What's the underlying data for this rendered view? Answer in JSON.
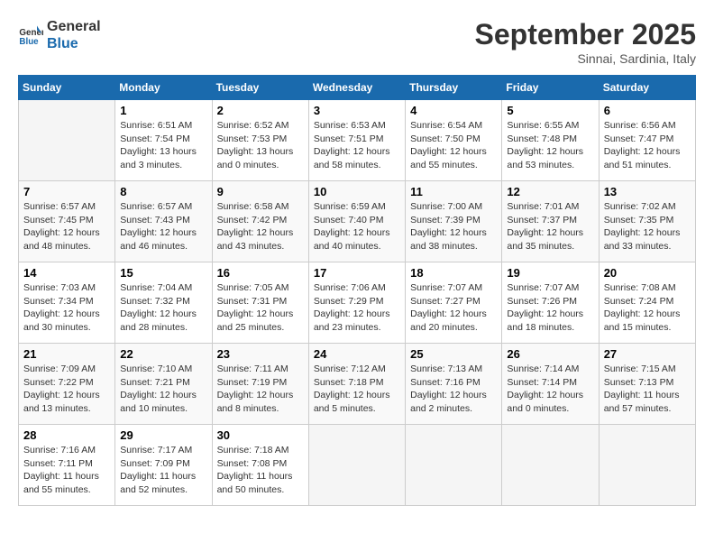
{
  "header": {
    "logo_line1": "General",
    "logo_line2": "Blue",
    "month": "September 2025",
    "location": "Sinnai, Sardinia, Italy"
  },
  "weekdays": [
    "Sunday",
    "Monday",
    "Tuesday",
    "Wednesday",
    "Thursday",
    "Friday",
    "Saturday"
  ],
  "weeks": [
    [
      {
        "day": "",
        "sunrise": "",
        "sunset": "",
        "daylight": ""
      },
      {
        "day": "1",
        "sunrise": "Sunrise: 6:51 AM",
        "sunset": "Sunset: 7:54 PM",
        "daylight": "Daylight: 13 hours and 3 minutes."
      },
      {
        "day": "2",
        "sunrise": "Sunrise: 6:52 AM",
        "sunset": "Sunset: 7:53 PM",
        "daylight": "Daylight: 13 hours and 0 minutes."
      },
      {
        "day": "3",
        "sunrise": "Sunrise: 6:53 AM",
        "sunset": "Sunset: 7:51 PM",
        "daylight": "Daylight: 12 hours and 58 minutes."
      },
      {
        "day": "4",
        "sunrise": "Sunrise: 6:54 AM",
        "sunset": "Sunset: 7:50 PM",
        "daylight": "Daylight: 12 hours and 55 minutes."
      },
      {
        "day": "5",
        "sunrise": "Sunrise: 6:55 AM",
        "sunset": "Sunset: 7:48 PM",
        "daylight": "Daylight: 12 hours and 53 minutes."
      },
      {
        "day": "6",
        "sunrise": "Sunrise: 6:56 AM",
        "sunset": "Sunset: 7:47 PM",
        "daylight": "Daylight: 12 hours and 51 minutes."
      }
    ],
    [
      {
        "day": "7",
        "sunrise": "Sunrise: 6:57 AM",
        "sunset": "Sunset: 7:45 PM",
        "daylight": "Daylight: 12 hours and 48 minutes."
      },
      {
        "day": "8",
        "sunrise": "Sunrise: 6:57 AM",
        "sunset": "Sunset: 7:43 PM",
        "daylight": "Daylight: 12 hours and 46 minutes."
      },
      {
        "day": "9",
        "sunrise": "Sunrise: 6:58 AM",
        "sunset": "Sunset: 7:42 PM",
        "daylight": "Daylight: 12 hours and 43 minutes."
      },
      {
        "day": "10",
        "sunrise": "Sunrise: 6:59 AM",
        "sunset": "Sunset: 7:40 PM",
        "daylight": "Daylight: 12 hours and 40 minutes."
      },
      {
        "day": "11",
        "sunrise": "Sunrise: 7:00 AM",
        "sunset": "Sunset: 7:39 PM",
        "daylight": "Daylight: 12 hours and 38 minutes."
      },
      {
        "day": "12",
        "sunrise": "Sunrise: 7:01 AM",
        "sunset": "Sunset: 7:37 PM",
        "daylight": "Daylight: 12 hours and 35 minutes."
      },
      {
        "day": "13",
        "sunrise": "Sunrise: 7:02 AM",
        "sunset": "Sunset: 7:35 PM",
        "daylight": "Daylight: 12 hours and 33 minutes."
      }
    ],
    [
      {
        "day": "14",
        "sunrise": "Sunrise: 7:03 AM",
        "sunset": "Sunset: 7:34 PM",
        "daylight": "Daylight: 12 hours and 30 minutes."
      },
      {
        "day": "15",
        "sunrise": "Sunrise: 7:04 AM",
        "sunset": "Sunset: 7:32 PM",
        "daylight": "Daylight: 12 hours and 28 minutes."
      },
      {
        "day": "16",
        "sunrise": "Sunrise: 7:05 AM",
        "sunset": "Sunset: 7:31 PM",
        "daylight": "Daylight: 12 hours and 25 minutes."
      },
      {
        "day": "17",
        "sunrise": "Sunrise: 7:06 AM",
        "sunset": "Sunset: 7:29 PM",
        "daylight": "Daylight: 12 hours and 23 minutes."
      },
      {
        "day": "18",
        "sunrise": "Sunrise: 7:07 AM",
        "sunset": "Sunset: 7:27 PM",
        "daylight": "Daylight: 12 hours and 20 minutes."
      },
      {
        "day": "19",
        "sunrise": "Sunrise: 7:07 AM",
        "sunset": "Sunset: 7:26 PM",
        "daylight": "Daylight: 12 hours and 18 minutes."
      },
      {
        "day": "20",
        "sunrise": "Sunrise: 7:08 AM",
        "sunset": "Sunset: 7:24 PM",
        "daylight": "Daylight: 12 hours and 15 minutes."
      }
    ],
    [
      {
        "day": "21",
        "sunrise": "Sunrise: 7:09 AM",
        "sunset": "Sunset: 7:22 PM",
        "daylight": "Daylight: 12 hours and 13 minutes."
      },
      {
        "day": "22",
        "sunrise": "Sunrise: 7:10 AM",
        "sunset": "Sunset: 7:21 PM",
        "daylight": "Daylight: 12 hours and 10 minutes."
      },
      {
        "day": "23",
        "sunrise": "Sunrise: 7:11 AM",
        "sunset": "Sunset: 7:19 PM",
        "daylight": "Daylight: 12 hours and 8 minutes."
      },
      {
        "day": "24",
        "sunrise": "Sunrise: 7:12 AM",
        "sunset": "Sunset: 7:18 PM",
        "daylight": "Daylight: 12 hours and 5 minutes."
      },
      {
        "day": "25",
        "sunrise": "Sunrise: 7:13 AM",
        "sunset": "Sunset: 7:16 PM",
        "daylight": "Daylight: 12 hours and 2 minutes."
      },
      {
        "day": "26",
        "sunrise": "Sunrise: 7:14 AM",
        "sunset": "Sunset: 7:14 PM",
        "daylight": "Daylight: 12 hours and 0 minutes."
      },
      {
        "day": "27",
        "sunrise": "Sunrise: 7:15 AM",
        "sunset": "Sunset: 7:13 PM",
        "daylight": "Daylight: 11 hours and 57 minutes."
      }
    ],
    [
      {
        "day": "28",
        "sunrise": "Sunrise: 7:16 AM",
        "sunset": "Sunset: 7:11 PM",
        "daylight": "Daylight: 11 hours and 55 minutes."
      },
      {
        "day": "29",
        "sunrise": "Sunrise: 7:17 AM",
        "sunset": "Sunset: 7:09 PM",
        "daylight": "Daylight: 11 hours and 52 minutes."
      },
      {
        "day": "30",
        "sunrise": "Sunrise: 7:18 AM",
        "sunset": "Sunset: 7:08 PM",
        "daylight": "Daylight: 11 hours and 50 minutes."
      },
      {
        "day": "",
        "sunrise": "",
        "sunset": "",
        "daylight": ""
      },
      {
        "day": "",
        "sunrise": "",
        "sunset": "",
        "daylight": ""
      },
      {
        "day": "",
        "sunrise": "",
        "sunset": "",
        "daylight": ""
      },
      {
        "day": "",
        "sunrise": "",
        "sunset": "",
        "daylight": ""
      }
    ]
  ]
}
